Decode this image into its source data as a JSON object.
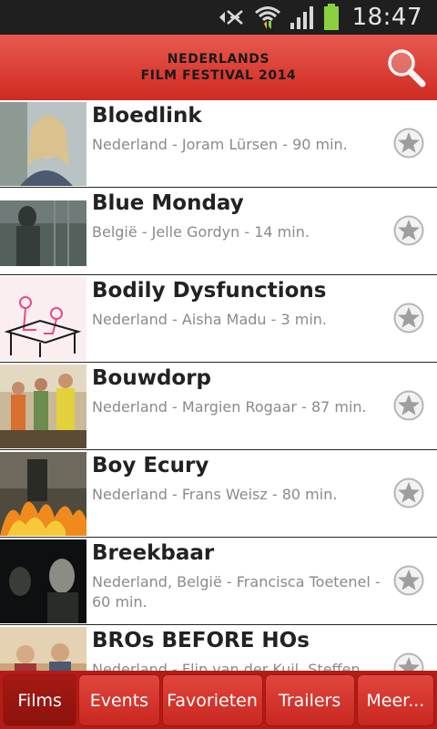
{
  "status_bar": {
    "time": "18:47",
    "icons": [
      "mute-icon",
      "wifi-icon",
      "signal-icon",
      "battery-icon"
    ]
  },
  "header": {
    "logo_line1": "NEDERLANDS",
    "logo_line2": "FILM FESTIVAL 2014",
    "search_icon": "search-icon"
  },
  "films": [
    {
      "title": "Bloedlink",
      "meta": "Nederland - Joram Lürsen - 90 min."
    },
    {
      "title": "Blue Monday",
      "meta": "België - Jelle Gordyn - 14 min."
    },
    {
      "title": "Bodily Dysfunctions",
      "meta": "Nederland - Aisha Madu - 3 min."
    },
    {
      "title": "Bouwdorp",
      "meta": "Nederland - Margien Rogaar - 87 min."
    },
    {
      "title": "Boy Ecury",
      "meta": "Nederland - Frans Weisz - 80 min."
    },
    {
      "title": "Breekbaar",
      "meta": "Nederland, België - Francisca Toetenel - 60 min."
    },
    {
      "title": "BROs BEFORE HOs",
      "meta": "Nederland - Flip van der Kuil, Steffen"
    }
  ],
  "tabs": [
    {
      "label": "Films",
      "active": true
    },
    {
      "label": "Events",
      "active": false
    },
    {
      "label": "Favorieten",
      "active": false
    },
    {
      "label": "Trailers",
      "active": false
    },
    {
      "label": "Meer...",
      "active": false
    }
  ],
  "colors": {
    "header_top": "#e8594f",
    "header_bottom": "#cf2a22",
    "tab_bg": "#c8271f",
    "tab_active_bg": "#8c120d"
  }
}
